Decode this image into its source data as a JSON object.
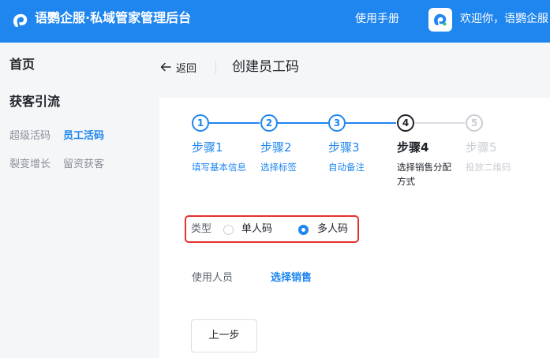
{
  "header": {
    "app_title": "语鹦企服·私域管家管理后台",
    "manual_label": "使用手册",
    "welcome_text": "欢迎你，语鹦企服",
    "brand_color": "#1f86f0",
    "logo_icon": "parrot-logo-icon",
    "avatar_icon": "parrot-avatar-icon"
  },
  "sidebar": {
    "home_label": "首页",
    "group_label": "获客引流",
    "items": [
      {
        "label": "超级活码",
        "active": false
      },
      {
        "label": "员工活码",
        "active": true
      },
      {
        "label": "裂变增长",
        "active": false
      },
      {
        "label": "留资获客",
        "active": false
      }
    ]
  },
  "page": {
    "back_label": "返回",
    "back_icon": "arrow-left-icon",
    "title": "创建员工码"
  },
  "steps": [
    {
      "number": "1",
      "title": "步骤1",
      "desc": "填写基本信息",
      "state": "done"
    },
    {
      "number": "2",
      "title": "步骤2",
      "desc": "选择标签",
      "state": "done"
    },
    {
      "number": "3",
      "title": "步骤3",
      "desc": "自动备注",
      "state": "done"
    },
    {
      "number": "4",
      "title": "步骤4",
      "desc": "选择销售分配方式",
      "state": "current"
    },
    {
      "number": "5",
      "title": "步骤5",
      "desc": "投放二维码",
      "state": "pending"
    }
  ],
  "form": {
    "type_label": "类型",
    "type_options": [
      {
        "label": "单人码",
        "selected": false
      },
      {
        "label": "多人码",
        "selected": true
      }
    ],
    "user_label": "使用人员",
    "select_sales_label": "选择销售",
    "highlight_color": "#e5332a"
  },
  "footer": {
    "prev_label": "上一步"
  }
}
